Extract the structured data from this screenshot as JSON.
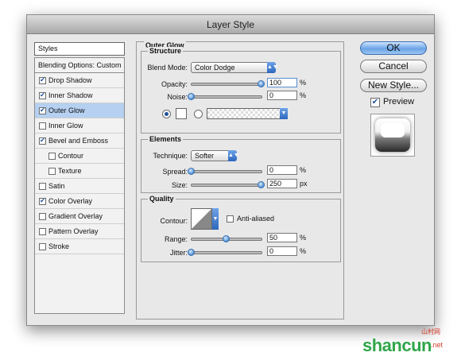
{
  "window": {
    "title": "Layer Style"
  },
  "sidebar": {
    "header": "Styles",
    "blending": "Blending Options: Custom",
    "items": [
      {
        "label": "Drop Shadow",
        "checked": true,
        "indent": false,
        "selected": false
      },
      {
        "label": "Inner Shadow",
        "checked": true,
        "indent": false,
        "selected": false
      },
      {
        "label": "Outer Glow",
        "checked": true,
        "indent": false,
        "selected": true
      },
      {
        "label": "Inner Glow",
        "checked": false,
        "indent": false,
        "selected": false
      },
      {
        "label": "Bevel and Emboss",
        "checked": true,
        "indent": false,
        "selected": false
      },
      {
        "label": "Contour",
        "checked": false,
        "indent": true,
        "selected": false
      },
      {
        "label": "Texture",
        "checked": false,
        "indent": true,
        "selected": false
      },
      {
        "label": "Satin",
        "checked": false,
        "indent": false,
        "selected": false
      },
      {
        "label": "Color Overlay",
        "checked": true,
        "indent": false,
        "selected": false
      },
      {
        "label": "Gradient Overlay",
        "checked": false,
        "indent": false,
        "selected": false
      },
      {
        "label": "Pattern Overlay",
        "checked": false,
        "indent": false,
        "selected": false
      },
      {
        "label": "Stroke",
        "checked": false,
        "indent": false,
        "selected": false
      }
    ]
  },
  "panel": {
    "title": "Outer Glow",
    "structure": {
      "title": "Structure",
      "blend_mode_label": "Blend Mode:",
      "blend_mode_value": "Color Dodge",
      "opacity_label": "Opacity:",
      "opacity_value": "100",
      "opacity_level": 1.0,
      "noise_label": "Noise:",
      "noise_value": "0",
      "noise_level": 0.0,
      "unit": "%"
    },
    "elements": {
      "title": "Elements",
      "technique_label": "Technique:",
      "technique_value": "Softer",
      "spread_label": "Spread:",
      "spread_value": "0",
      "spread_level": 0.0,
      "size_label": "Size:",
      "size_value": "250",
      "size_level": 1.0,
      "spread_unit": "%",
      "size_unit": "px"
    },
    "quality": {
      "title": "Quality",
      "contour_label": "Contour:",
      "anti_aliased_label": "Anti-aliased",
      "range_label": "Range:",
      "range_value": "50",
      "range_level": 0.5,
      "jitter_label": "Jitter:",
      "jitter_value": "0",
      "jitter_level": 0.0,
      "unit": "%"
    }
  },
  "buttons": {
    "ok": "OK",
    "cancel": "Cancel",
    "new_style": "New Style...",
    "preview": "Preview",
    "preview_checked": true
  },
  "watermark": {
    "text": "shancun",
    "sub": "山村网",
    "net": ".net"
  },
  "colors": {
    "accent": "#4f8fd6",
    "selection": "#b5d0f0",
    "watermark_green": "#2fa64a",
    "watermark_red": "#d23a2a"
  }
}
